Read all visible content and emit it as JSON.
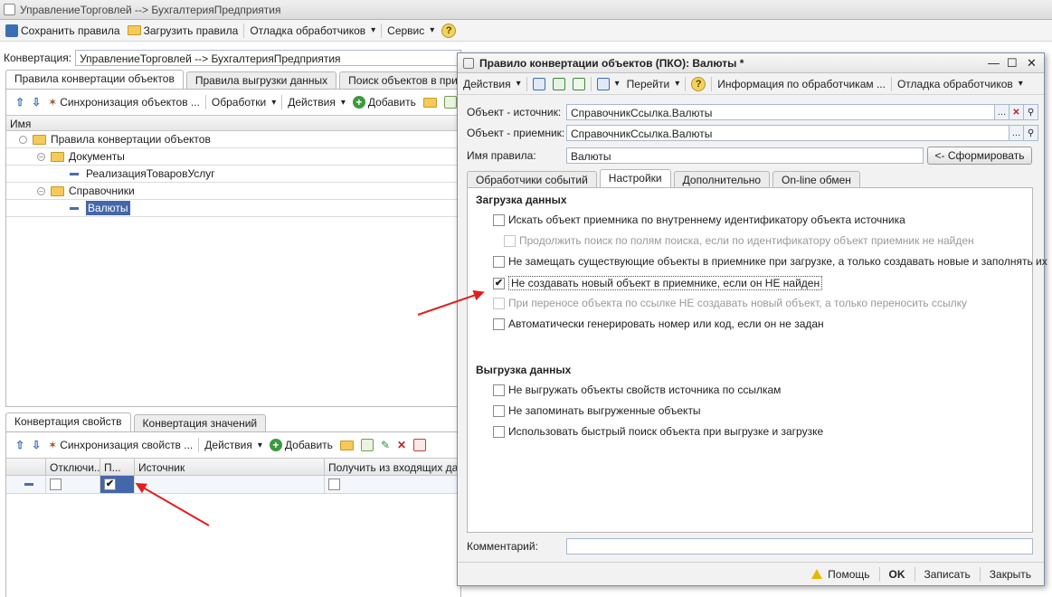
{
  "window": {
    "title": "УправлениеТорговлей --> БухгалтерияПредприятия"
  },
  "main_toolbar": {
    "save_rules": "Сохранить правила",
    "load_rules": "Загрузить правила",
    "debug_handlers": "Отладка обработчиков",
    "service": "Сервис",
    "help_icon": "?"
  },
  "conversion": {
    "label": "Конвертация:",
    "value": "УправлениеТорговлей --> БухгалтерияПредприятия"
  },
  "top_tabs": [
    "Правила конвертации объектов",
    "Правила выгрузки данных",
    "Поиск объектов в приемник"
  ],
  "tree_toolbar": {
    "sync": "Синхронизация объектов ...",
    "processing": "Обработки",
    "actions": "Действия",
    "add": "Добавить"
  },
  "tree": {
    "header": "Имя",
    "rows": [
      {
        "label": "Правила конвертации объектов",
        "kind": "root"
      },
      {
        "label": "Документы",
        "kind": "folder"
      },
      {
        "label": "РеализацияТоваровУслуг",
        "kind": "item"
      },
      {
        "label": "Справочники",
        "kind": "folder"
      },
      {
        "label": "Валюты",
        "kind": "item",
        "selected": true
      }
    ]
  },
  "bottom_tabs": [
    "Конвертация свойств",
    "Конвертация значений"
  ],
  "props_toolbar": {
    "sync": "Синхронизация свойств ...",
    "actions": "Действия",
    "add": "Добавить"
  },
  "props_grid": {
    "columns": [
      "Отключи...",
      "П...",
      "Источник",
      "Получить из входящих данны"
    ],
    "row": {
      "disabled": false,
      "p_checked": true
    }
  },
  "dialog": {
    "title": "Правило конвертации объектов (ПКО): Валюты *",
    "toolbar": {
      "actions": "Действия",
      "go": "Перейти",
      "help": "?",
      "handlers_info": "Информация по обработчикам ...",
      "debug": "Отладка обработчиков"
    },
    "source_label": "Объект - источник:",
    "source_value": "СправочникСсылка.Валюты",
    "target_label": "Объект - приемник:",
    "target_value": "СправочникСсылка.Валюты",
    "rule_name_label": "Имя правила:",
    "rule_name_value": "Валюты",
    "generate_button": "<- Сформировать",
    "tabs": [
      "Обработчики событий",
      "Настройки",
      "Дополнительно",
      "On-line обмен"
    ],
    "load_section": "Загрузка данных",
    "load_options": [
      {
        "label": "Искать объект приемника по внутреннему идентификатору объекта источника",
        "checked": false,
        "enabled": true
      },
      {
        "label": "Продолжить поиск по полям поиска, если по идентификатору объект приемник не найден",
        "checked": false,
        "enabled": false
      },
      {
        "label": "Не замещать существующие объекты в приемнике при загрузке, а только создавать новые и заполнять их",
        "checked": false,
        "enabled": true
      },
      {
        "label": "Не создавать новый объект в приемнике, если он НЕ найден",
        "checked": true,
        "enabled": true
      },
      {
        "label": "При переносе объекта по ссылке НЕ создавать новый объект, а только переносить ссылку",
        "checked": false,
        "enabled": false
      },
      {
        "label": "Автоматически генерировать номер или код, если он не задан",
        "checked": false,
        "enabled": true
      }
    ],
    "unload_section": "Выгрузка данных",
    "unload_options": [
      {
        "label": "Не выгружать объекты свойств источника по ссылкам",
        "checked": false
      },
      {
        "label": "Не запоминать выгруженные объекты",
        "checked": false
      },
      {
        "label": "Использовать быстрый поиск объекта при выгрузке и загрузке",
        "checked": false
      }
    ],
    "comment_label": "Комментарий:",
    "comment_value": "",
    "footer": {
      "help": "Помощь",
      "ok": "OK",
      "save": "Записать",
      "close": "Закрыть"
    }
  },
  "colors": {
    "arrow": "#e02020",
    "selection": "#4466aa",
    "folder": "#f5c95a"
  }
}
